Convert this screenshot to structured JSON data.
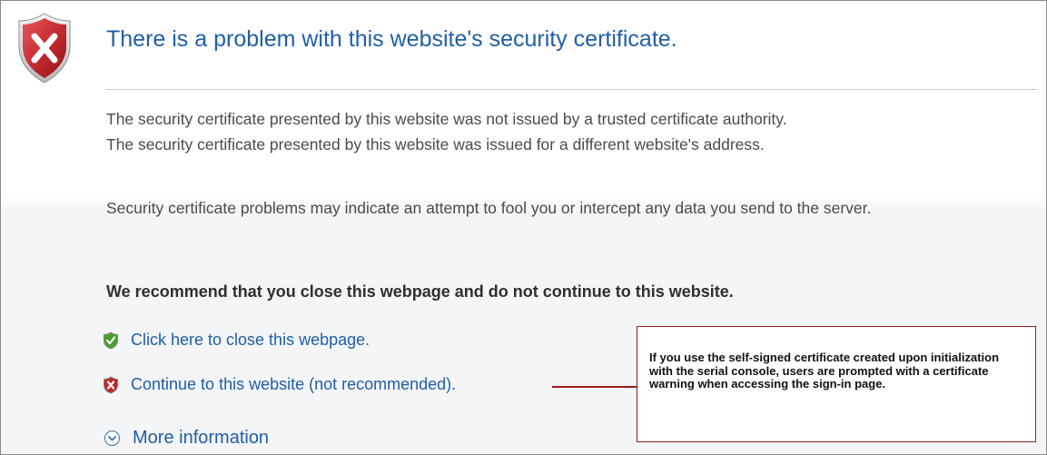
{
  "page": {
    "title": "There is a problem with this website's security certificate.",
    "paragraph_1_line_1": "The security certificate presented by this website was not issued by a trusted certificate authority.",
    "paragraph_1_line_2": "The security certificate presented by this website was issued for a different website's address.",
    "paragraph_2": "Security certificate problems may indicate an attempt to fool you or intercept any data you send to the server.",
    "recommendation": "We recommend that you close this webpage and do not continue to this website.",
    "options": {
      "close_label": "Click here to close this webpage.",
      "continue_label": "Continue to this website (not recommended)."
    },
    "more_info_label": "More information"
  },
  "callout": {
    "text": "If you use the self-signed certificate created upon initialization with the serial console, users are prompted with a certificate warning when accessing the sign-in page."
  },
  "icons": {
    "main": "error-shield-icon",
    "close_option": "green-shield-check-icon",
    "continue_option": "red-shield-x-icon",
    "more_info": "chevron-down-circle-icon"
  },
  "colors": {
    "title": "#1f5fa6",
    "link": "#1f5fa6",
    "body_text": "#4a4a4a",
    "callout_border": "#a11a1a",
    "error_shield": "#c0282d",
    "safe_shield": "#4aa02c"
  }
}
